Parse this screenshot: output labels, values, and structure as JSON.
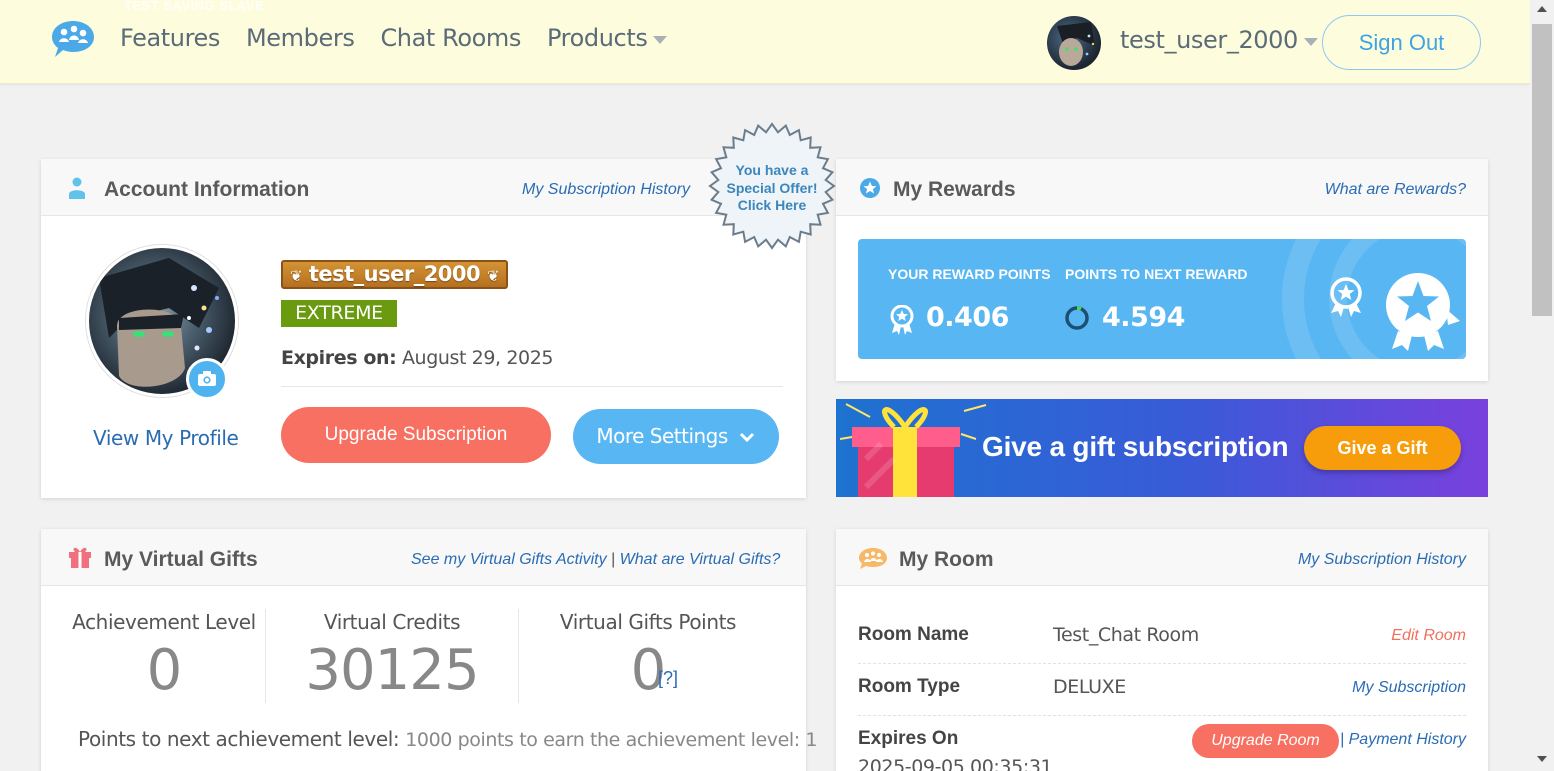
{
  "header": {
    "ghost_text": "TEST SAVING SLAVE",
    "nav": [
      {
        "label": "Features"
      },
      {
        "label": "Members"
      },
      {
        "label": "Chat Rooms"
      },
      {
        "label": "Products"
      }
    ],
    "username": "test_user_2000",
    "sign_out": "Sign Out"
  },
  "account": {
    "title": "Account Information",
    "subscription_history_link": "My Subscription History",
    "view_profile": "View My Profile",
    "username_badge": "test_user_2000",
    "tier": "EXTREME",
    "expires_label": "Expires on:",
    "expires_value": "August 29, 2025",
    "upgrade_button": "Upgrade Subscription",
    "more_settings_button": "More Settings"
  },
  "special_offer": {
    "line1": "You have a",
    "line2": "Special Offer!",
    "line3": "Click Here"
  },
  "rewards": {
    "title": "My Rewards",
    "what_link": "What are Rewards?",
    "points_label": "YOUR REWARD POINTS",
    "points_value": "0.406",
    "next_label": "POINTS TO NEXT REWARD",
    "next_value": "4.594"
  },
  "gift_banner": {
    "text": "Give a gift subscription",
    "button": "Give a Gift"
  },
  "virtual_gifts": {
    "title": "My Virtual Gifts",
    "activity_link": "See my Virtual Gifts Activity",
    "separator": "|",
    "what_link": "What are Virtual Gifts?",
    "stats": [
      {
        "label": "Achievement Level",
        "value": "0"
      },
      {
        "label": "Virtual Credits",
        "value": "30125"
      },
      {
        "label": "Virtual Gifts Points",
        "value": "0"
      }
    ],
    "help": "[?]",
    "points_next_label": "Points to next achievement level:",
    "points_next_value": "1000 points to earn the achievement level: 1"
  },
  "room": {
    "title": "My Room",
    "subscription_history_link": "My Subscription History",
    "rows": [
      {
        "key": "Room Name",
        "value": "Test_Chat Room",
        "link": "Edit Room"
      },
      {
        "key": "Room Type",
        "value": "DELUXE",
        "link": "My Subscription"
      },
      {
        "key": "Expires On",
        "value": "2025-09-05 00:35:31",
        "link": "| Payment History"
      }
    ],
    "upgrade_button": "Upgrade Room"
  },
  "colors": {
    "header_bg": "#fdfdde",
    "link_blue": "#2a6cb3",
    "accent_blue": "#58b6f2",
    "accent_red": "#f87061",
    "tier_green": "#6a9a0f"
  }
}
